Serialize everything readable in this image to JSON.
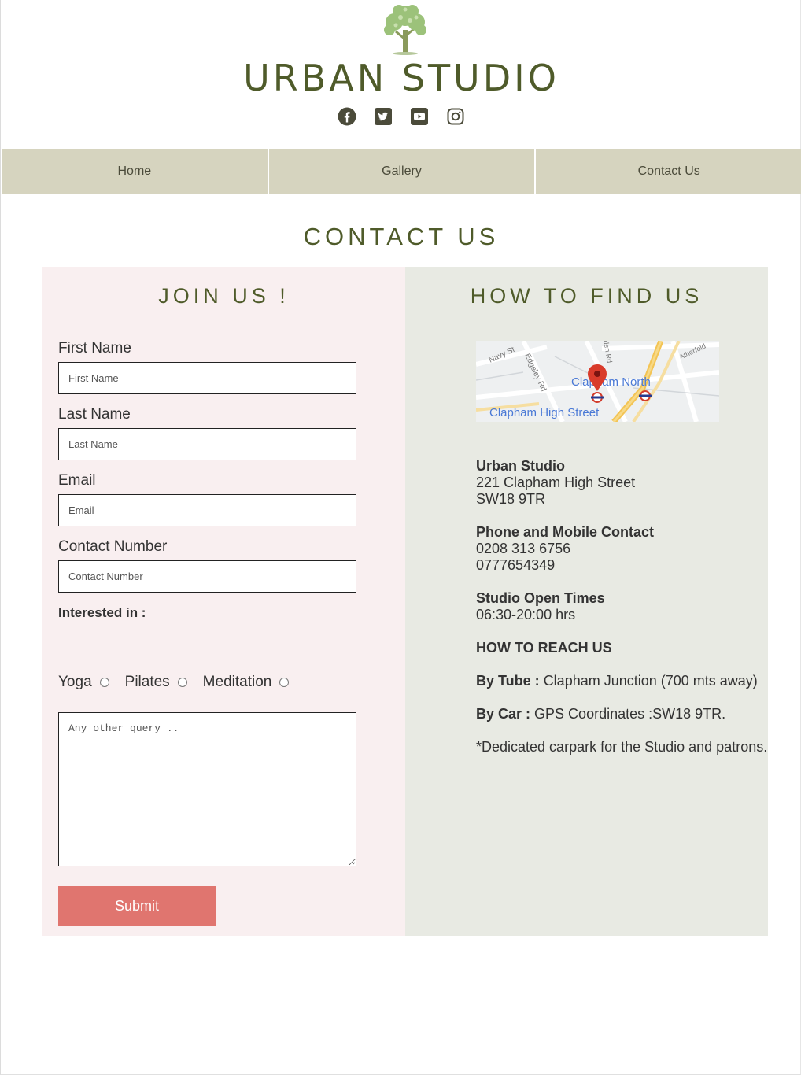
{
  "header": {
    "brand": "URBAN STUDIO",
    "social": [
      "facebook-icon",
      "twitter-icon",
      "youtube-icon",
      "instagram-icon"
    ]
  },
  "nav": [
    "Home",
    "Gallery",
    "Contact Us"
  ],
  "page_title": "CONTACT US",
  "join": {
    "title": "JOIN US !",
    "fields": [
      {
        "label": "First Name",
        "placeholder": "First Name"
      },
      {
        "label": "Last Name",
        "placeholder": "Last Name"
      },
      {
        "label": "Email",
        "placeholder": "Email"
      },
      {
        "label": "Contact Number",
        "placeholder": "Contact Number"
      }
    ],
    "interested_label": "Interested in :",
    "options": [
      "Yoga",
      "Pilates",
      "Meditation"
    ],
    "query_placeholder": "Any other query ..",
    "submit": "Submit"
  },
  "find": {
    "title": "HOW TO FIND US",
    "map_labels": [
      "Navy St",
      "Edgeley Rd",
      "Clapham North",
      "Clapham High Street",
      "Atherfold",
      "den Rd"
    ],
    "studio_name": "Urban Studio",
    "address_line1": "221 Clapham High Street",
    "address_line2": "SW18 9TR",
    "phone_heading": "Phone and Mobile Contact",
    "phone1": "0208 313 6756",
    "phone2": "0777654349",
    "times_heading": "Studio Open Times",
    "times": "06:30-20:00 hrs",
    "reach_heading": "HOW TO REACH US",
    "tube_label": "By Tube :",
    "tube_text": "Clapham Junction (700 mts away)",
    "car_label": "By Car :",
    "car_text": "GPS Coordinates :SW18 9TR.",
    "parking_note": "*Dedicated carpark for the Studio and patrons."
  },
  "colors": {
    "brand_green": "#4f5b2a",
    "nav_bg": "#d6d4bf",
    "join_bg": "#f9eff0",
    "find_bg": "#e8eae3",
    "submit_bg": "#e0756f"
  }
}
